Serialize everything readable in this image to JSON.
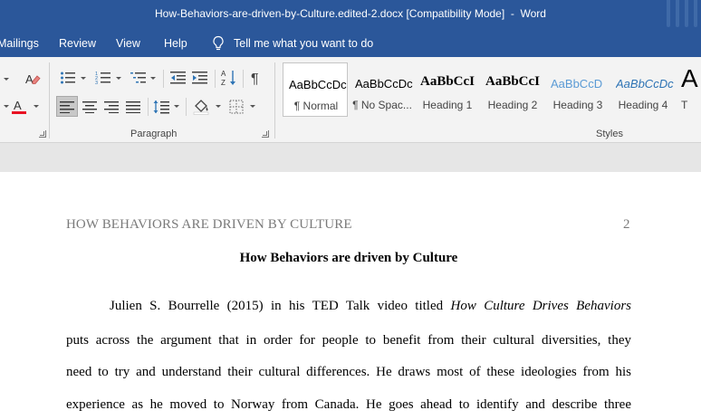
{
  "window": {
    "title": "How-Behaviors-are-driven-by-Culture.edited-2.docx [Compatibility Mode]  -  Word"
  },
  "menu": {
    "tabs": [
      {
        "label": "Mailings"
      },
      {
        "label": "Review"
      },
      {
        "label": "View"
      },
      {
        "label": "Help"
      }
    ],
    "tell_me": "Tell me what you want to do"
  },
  "ribbon": {
    "paragraph_group_label": "Paragraph",
    "styles_group_label": "Styles",
    "styles": [
      {
        "sample": "AaBbCcDc",
        "name": "¶ Normal",
        "selected": true
      },
      {
        "sample": "AaBbCcDc",
        "name": "¶ No Spac..."
      },
      {
        "sample": "AaBbCcI",
        "name": "Heading 1"
      },
      {
        "sample": "AaBbCcI",
        "name": "Heading 2"
      },
      {
        "sample": "AaBbCcD",
        "name": "Heading 3"
      },
      {
        "sample": "AaBbCcDc",
        "name": "Heading 4"
      },
      {
        "sample": "A",
        "name": "T"
      }
    ],
    "colors": {
      "font_color": "#e81123",
      "heading_color": "#2e74b5",
      "heading_light_color": "#5b9bd5"
    }
  },
  "document": {
    "header": "HOW BEHAVIORS ARE DRIVEN BY CULTURE",
    "page_number": "2",
    "title": "How Behaviors are driven by Culture",
    "line1_pre": "Julien S. Bourrelle (2015) in his TED Talk video titled ",
    "line1_italic": "How Culture Drives Behaviors",
    "line2": "puts across the argument that in order for people to benefit from their cultural diversities, they",
    "line3": "need to try and understand their cultural differences. He draws most of these ideologies from his",
    "line4": "experience as he moved to Norway from Canada. He goes ahead to identify and describe three"
  },
  "theme": {
    "title_bar_color": "#2b579a",
    "ribbon_bg": "#f3f3f3"
  }
}
